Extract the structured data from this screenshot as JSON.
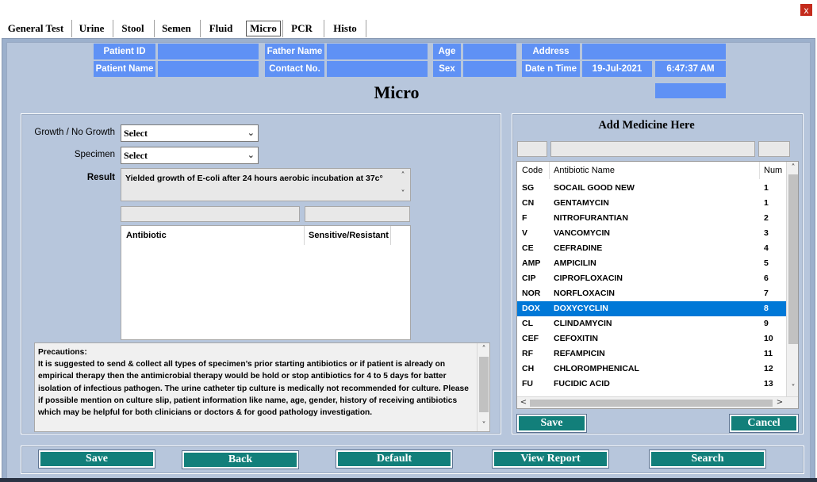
{
  "window": {
    "close_label": "x"
  },
  "tabs": [
    "General Test",
    "Urine",
    "Stool",
    "Semen",
    "Fluid",
    "Micro",
    "PCR",
    "Histo"
  ],
  "active_tab": "Micro",
  "patient_header": {
    "patient_id_label": "Patient ID",
    "patient_id_value": "",
    "patient_name_label": "Patient Name",
    "patient_name_value": "",
    "father_name_label": "Father Name",
    "father_name_value": "",
    "contact_label": "Contact No.",
    "contact_value": "",
    "age_label": "Age",
    "age_value": "",
    "sex_label": "Sex",
    "sex_value": "",
    "address_label": "Address",
    "address_value": "",
    "datetime_label": "Date n Time",
    "date_value": "19-Jul-2021",
    "time_value": "6:47:37 AM"
  },
  "page_title": "Micro",
  "form": {
    "growth_label": "Growth / No Growth",
    "growth_value": "Select",
    "specimen_label": "Specimen",
    "specimen_value": "Select",
    "result_label": "Result",
    "result_value": "Yielded growth of E-coli after 24 hours aerobic incubation at 37c°",
    "antibiotic_col": "Antibiotic",
    "sensitivity_col": "Sensitive/Resistant",
    "precautions": "Precautions:\nIt is suggested to send & collect all types of specimen’s prior starting antibiotics or if patient is already on empirical therapy then the antimicrobial therapy would be hold or stop antibiotics for 4 to 5 days for batter isolation of infectious pathogen. The urine catheter tip culture is medically not recommended for culture. Please if possible mention on culture slip, patient information like name, age, gender, history of receiving antibiotics which may be helpful for both clinicians or doctors & for good pathology investigation."
  },
  "medicine": {
    "title": "Add Medicine Here",
    "columns": {
      "code": "Code",
      "name": "Antibiotic Name",
      "num": "Num"
    },
    "rows": [
      {
        "code": "SG",
        "name": "SOCAIL GOOD NEW",
        "num": "1"
      },
      {
        "code": "CN",
        "name": "GENTAMYCIN",
        "num": "1"
      },
      {
        "code": "F",
        "name": "NITROFURANTIAN",
        "num": "2"
      },
      {
        "code": "V",
        "name": "VANCOMYCIN",
        "num": "3"
      },
      {
        "code": "CE",
        "name": "CEFRADINE",
        "num": "4"
      },
      {
        "code": "AMP",
        "name": "AMPICILIN",
        "num": "5"
      },
      {
        "code": "CIP",
        "name": "CIPROFLOXACIN",
        "num": "6"
      },
      {
        "code": "NOR",
        "name": "NORFLOXACIN",
        "num": "7"
      },
      {
        "code": "DOX",
        "name": "DOXYCYCLIN",
        "num": "8"
      },
      {
        "code": "CL",
        "name": "CLINDAMYCIN",
        "num": "9"
      },
      {
        "code": "CEF",
        "name": "CEFOXITIN",
        "num": "10"
      },
      {
        "code": "RF",
        "name": "REFAMPICIN",
        "num": "11"
      },
      {
        "code": "CH",
        "name": "CHLOROMPHENICAL",
        "num": "12"
      },
      {
        "code": "FU",
        "name": "FUCIDIC ACID",
        "num": "13"
      }
    ],
    "selected_code": "DOX",
    "save_label": "Save",
    "cancel_label": "Cancel"
  },
  "footer": {
    "save_label": "Save",
    "back_label": "Back",
    "default_label": "Default",
    "view_report_label": "View Report",
    "search_label": "Search"
  },
  "colors": {
    "header_blue": "#5f91f5",
    "button_teal": "#127f7a",
    "panel_bg": "#b7c6dc",
    "selected_row": "#0078d7"
  }
}
